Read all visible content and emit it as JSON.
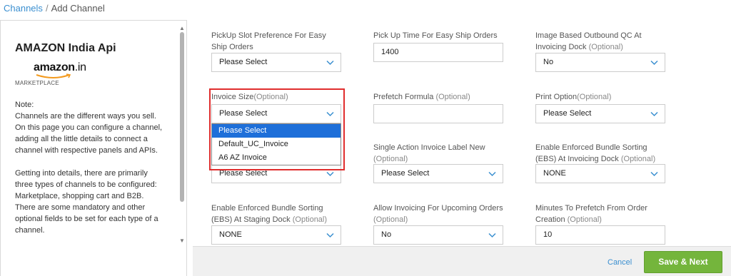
{
  "breadcrumb": {
    "parent": "Channels",
    "separator": "/",
    "current": "Add Channel"
  },
  "sidebar": {
    "title": "AMAZON India Api",
    "logo_text": "amazon",
    "logo_suffix": ".in",
    "channel_type": "MARKETPLACE",
    "note_title": "Note:",
    "note_para1": "Channels are the different ways you sell. On this page you can configure a channel, adding all the little details to connect a channel with respective panels and APIs.",
    "note_para2": "Getting into details, there are primarily three types of channels to be configured: Marketplace, shopping cart and B2B. There are some mandatory and other optional fields to be set for each type of a channel."
  },
  "form": {
    "pickup_slot": {
      "label": "PickUp Slot Preference For Easy Ship Orders",
      "value": "Please Select"
    },
    "pickup_time": {
      "label": "Pick Up Time For Easy Ship Orders",
      "value": "1400"
    },
    "image_qc": {
      "label": "Image Based Outbound QC At Invoicing Dock",
      "optional": "(Optional)",
      "value": "No"
    },
    "invoice_size": {
      "label": "Invoice Size",
      "optional": "(Optional)",
      "value": "Please Select"
    },
    "prefetch_formula": {
      "label": "Prefetch Formula",
      "optional": "(Optional)",
      "value": ""
    },
    "print_option": {
      "label": "Print Option",
      "optional": "(Optional)",
      "value": "Please Select"
    },
    "hidden_select": {
      "value": "Please Select"
    },
    "single_action": {
      "label": "Single Action Invoice Label New",
      "optional": "(Optional)",
      "value": "Please Select"
    },
    "ebs_invoicing": {
      "label": "Enable Enforced Bundle Sorting (EBS) At Invoicing Dock",
      "optional": "(Optional)",
      "value": "NONE"
    },
    "ebs_staging": {
      "label": "Enable Enforced Bundle Sorting (EBS) At Staging Dock",
      "optional": "(Optional)",
      "value": "NONE"
    },
    "upcoming_orders": {
      "label": "Allow Invoicing For Upcoming Orders",
      "optional": "(Optional)",
      "value": "No"
    },
    "prefetch_minutes": {
      "label": "Minutes To Prefetch From Order Creation",
      "optional": "(Optional)",
      "value": "10"
    }
  },
  "invoice_dropdown": {
    "options": [
      "Please Select",
      "Default_UC_Invoice",
      "A6 AZ Invoice"
    ],
    "selected_index": 0
  },
  "footer": {
    "cancel_label": "Cancel",
    "save_label": "Save & Next"
  },
  "colors": {
    "accent": "#3a8fd0",
    "save_green": "#74b53c",
    "highlight_red": "#e02d2d",
    "selected_blue": "#1e6fd9"
  }
}
